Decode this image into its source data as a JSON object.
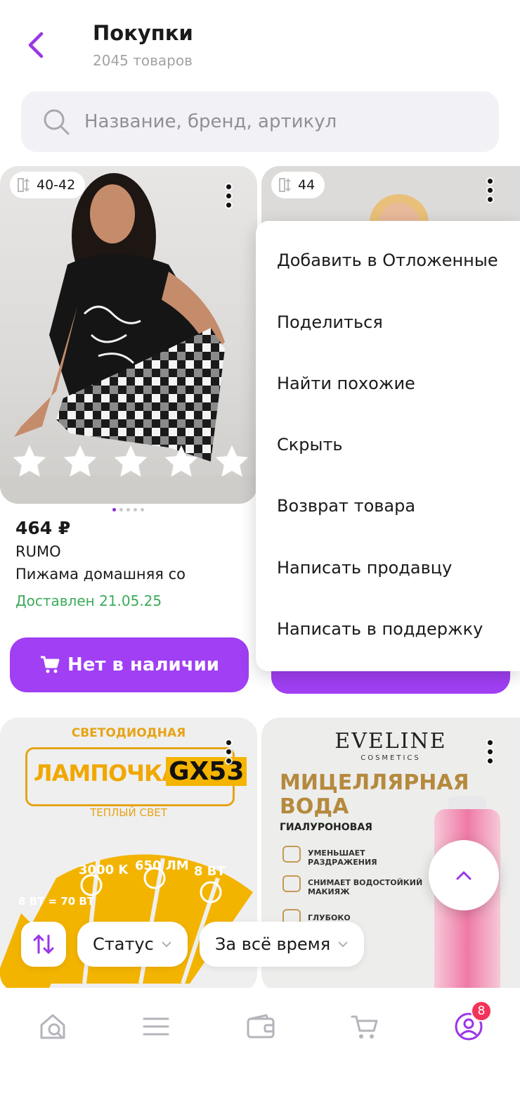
{
  "header": {
    "title": "Покупки",
    "subtitle": "2045 товаров"
  },
  "search": {
    "placeholder": "Название, бренд, артикул"
  },
  "products": [
    {
      "size": "40-42",
      "rating_stars": 5,
      "price": "464 ₽",
      "brand": "RUMO",
      "name": "Пижама домашняя со",
      "status": "Доставлен 21.05.25",
      "button_label": "Нет в наличии",
      "images_count": 5,
      "active_image": 1
    },
    {
      "size": "44"
    },
    {
      "image_text": {
        "top": "СВЕТОДИОДНАЯ",
        "title": "ЛАМПОЧКА",
        "model": "GX53",
        "subtitle": "ТЕПЛЫЙ СВЕТ",
        "specs": [
          "8 ВТ = 70 ВТ",
          "3000 K",
          "650 ЛМ",
          "8 ВТ"
        ]
      }
    },
    {
      "image_text": {
        "logo": "EVELINE",
        "logo_sub": "COSMETICS",
        "title_line1": "МИЦЕЛЛЯРНАЯ",
        "title_line2": "ВОДА",
        "subtitle": "ГИАЛУРОНОВАЯ",
        "features": [
          "УМЕНЬШАЕТ РАЗДРАЖЕНИЯ",
          "СНИМАЕТ ВОДОСТОЙКИЙ МАКИЯЖ",
          "ГЛУБОКО"
        ]
      }
    }
  ],
  "context_menu": {
    "items": [
      "Добавить в Отложенные",
      "Поделиться",
      "Найти похожие",
      "Скрыть",
      "Возврат товара",
      "Написать продавцу",
      "Написать в поддержку"
    ]
  },
  "filters": {
    "status_label": "Статус",
    "period_label": "За всё время"
  },
  "tabbar": {
    "items": [
      "home-search-icon",
      "menu-icon",
      "wallet-icon",
      "cart-icon",
      "profile-icon"
    ],
    "profile_badge": "8"
  },
  "colors": {
    "accent": "#a03ff3",
    "delivered": "#3dab5a",
    "badge": "#f2345a"
  }
}
